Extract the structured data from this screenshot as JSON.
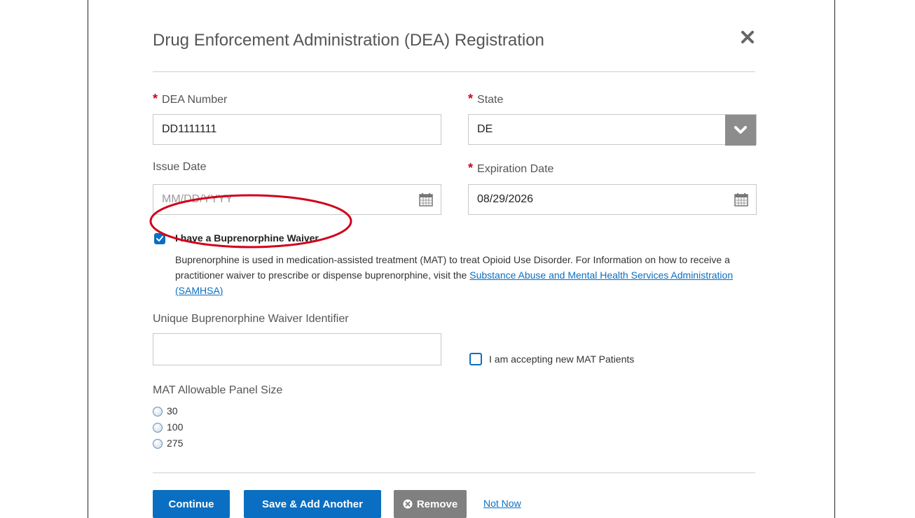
{
  "modal": {
    "title": "Drug Enforcement Administration (DEA) Registration"
  },
  "fields": {
    "dea_number": {
      "required_mark": "*",
      "label": "DEA Number",
      "value": "DD1111111"
    },
    "state": {
      "required_mark": "*",
      "label": "State",
      "value": "DE"
    },
    "issue_date": {
      "label": "Issue Date",
      "placeholder": "MM/DD/YYYY",
      "value": ""
    },
    "expiration_date": {
      "required_mark": "*",
      "label": "Expiration Date",
      "value": "08/29/2026"
    },
    "waiver_checkbox": {
      "label": "I have a Buprenorphine Waiver",
      "checked": true
    },
    "waiver_info": {
      "text": "Buprenorphine is used in medication-assisted treatment (MAT) to treat Opioid Use Disorder. For Information on how to receive a practitioner waiver to prescribe or dispense buprenorphine, visit the",
      "link": "Substance Abuse and Mental Health Services Administration (SAMHSA)"
    },
    "waiver_identifier": {
      "label": "Unique Buprenorphine Waiver Identifier",
      "value": ""
    },
    "accepting_mat": {
      "label": "I am accepting new MAT Patients",
      "checked": false
    },
    "panel_size": {
      "label": "MAT Allowable Panel Size",
      "options": [
        "30",
        "100",
        "275"
      ]
    }
  },
  "actions": {
    "continue": "Continue",
    "save_add": "Save & Add Another",
    "remove": "Remove",
    "not_now": "Not Now"
  },
  "colors": {
    "primary": "#0a6fc2",
    "required": "#d0021b",
    "annotation": "#d0021b",
    "remove_button": "#808080"
  },
  "icons": [
    "close-icon",
    "chevron-down-icon",
    "calendar-icon",
    "check-icon",
    "remove-icon"
  ]
}
